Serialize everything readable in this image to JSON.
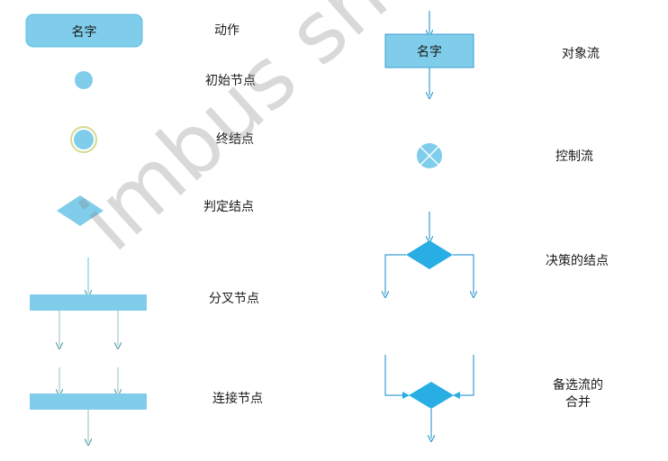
{
  "colors": {
    "fill_light": "#7fcdea",
    "fill_strong": "#29aee4",
    "stroke": "#3a9fd0",
    "arrow": "#5fa3a8",
    "final_ring": "#d8d890"
  },
  "left_column": {
    "action": {
      "box_text": "名字",
      "label": "动作"
    },
    "initial_node": {
      "label": "初始节点"
    },
    "final_node": {
      "label": "终结点"
    },
    "decision_node": {
      "label": "判定结点"
    },
    "fork_node": {
      "label": "分叉节点"
    },
    "join_node": {
      "label": "连接节点"
    }
  },
  "right_column": {
    "object_flow": {
      "box_text": "名字",
      "label": "对象流"
    },
    "control_flow": {
      "label": "控制流"
    },
    "decision_node": {
      "label": "决策的结点"
    },
    "merge": {
      "label_line1": "备选流的",
      "label_line2": "合并"
    }
  },
  "watermark": {
    "text": "imbus shanghai"
  }
}
